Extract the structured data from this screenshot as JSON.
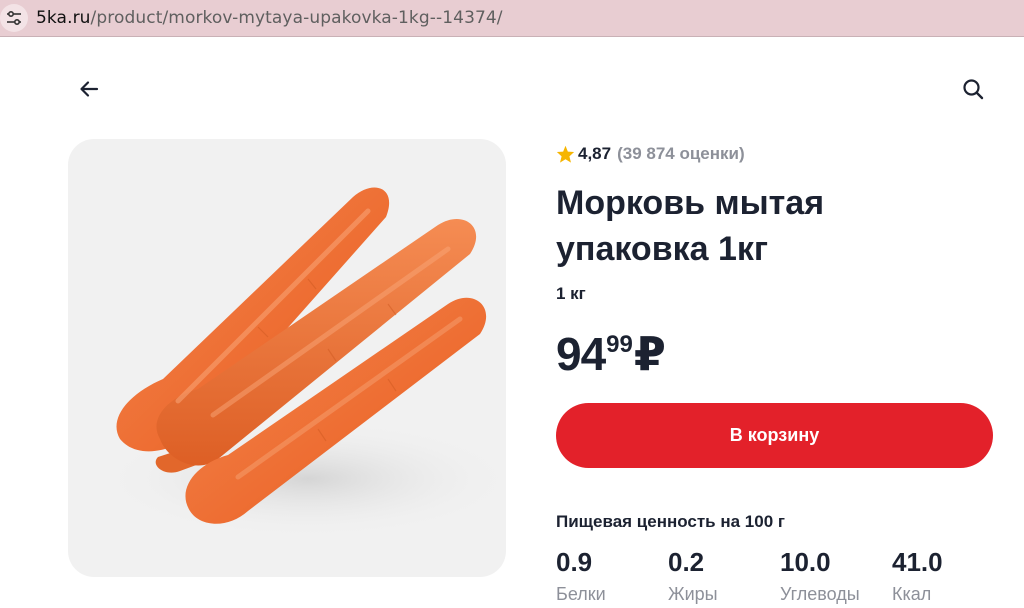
{
  "browser": {
    "url_host": "5ka.ru",
    "url_path": "/product/morkov-mytaya-upakovka-1kg--14374/",
    "site_icon": "tune-icon"
  },
  "header": {
    "back_icon": "arrow-left-icon",
    "search_icon": "search-icon"
  },
  "product": {
    "image": "carrots-photo",
    "rating_value": "4,87",
    "rating_count": "(39 874 оценки)",
    "title_line1": "Морковь мытая",
    "title_line2": "упаковка 1кг",
    "weight": "1 кг",
    "price_rub": "94",
    "price_kop": "99",
    "currency": "₽",
    "cart_button": "В корзину",
    "nutrition_title": "Пищевая ценность на 100 г",
    "nutrition": [
      {
        "value": "0.9",
        "label": "Белки"
      },
      {
        "value": "0.2",
        "label": "Жиры"
      },
      {
        "value": "10.0",
        "label": "Углеводы"
      },
      {
        "value": "41.0",
        "label": "Ккал"
      }
    ]
  },
  "colors": {
    "accent": "#e3212a",
    "star": "#f6b500",
    "text": "#1c2231",
    "muted": "#8d9099",
    "urlbar": "#e8cdd2"
  }
}
